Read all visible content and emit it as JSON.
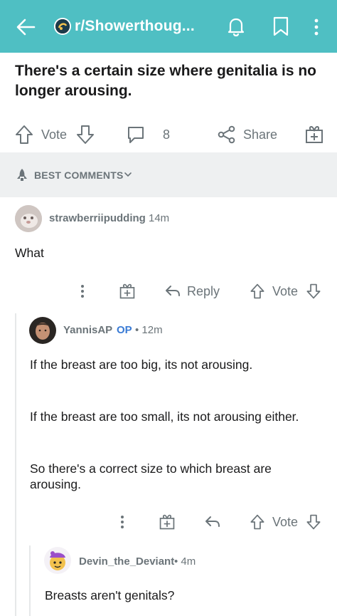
{
  "header": {
    "subreddit": "r/Showerthoug...",
    "accent": "#4fbfc3"
  },
  "post": {
    "title": "There's a certain size where genitalia is no longer arousing.",
    "vote_label": "Vote",
    "comment_count": "8",
    "share_label": "Share"
  },
  "sort": {
    "label": "BEST COMMENTS"
  },
  "comments": [
    {
      "user": "strawberriipudding",
      "age": "14m",
      "body": "What",
      "reply_label": "Reply",
      "vote_label": "Vote"
    },
    {
      "user": "YannisAP",
      "op": "OP",
      "age": "• 12m",
      "paragraphs": [
        "If the breast are too big, its not arousing.",
        "If the breast are too small, its not arousing either.",
        "So there's a correct size to which breast are arousing."
      ],
      "vote_label": "Vote"
    },
    {
      "user": "Devin_the_Deviant",
      "age": "• 4m",
      "body": "Breasts aren't genitals?"
    }
  ]
}
